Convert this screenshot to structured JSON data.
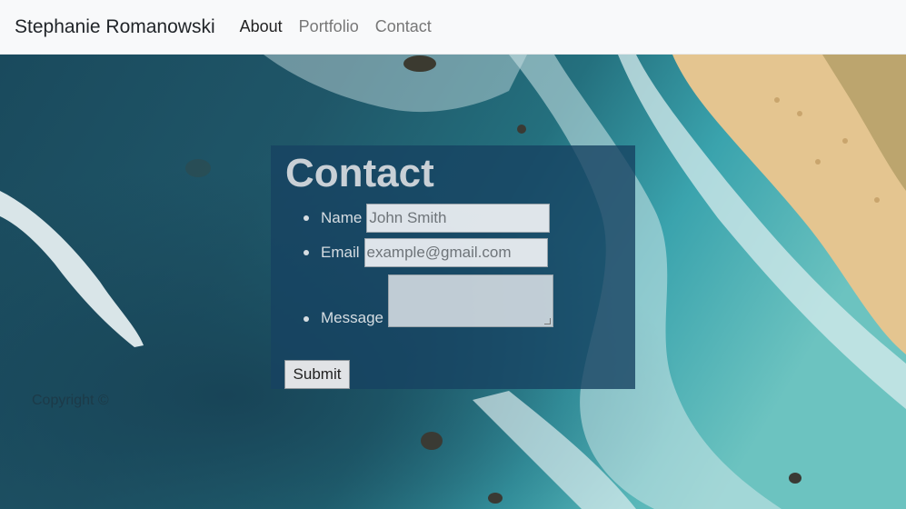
{
  "navbar": {
    "brand": "Stephanie Romanowski",
    "links": [
      "About",
      "Portfolio",
      "Contact"
    ]
  },
  "contact": {
    "title": "Contact",
    "fields": [
      {
        "label": "Name",
        "placeholder": "John Smith"
      },
      {
        "label": "Email",
        "placeholder": "example@gmail.com"
      },
      {
        "label": "Message",
        "placeholder": ""
      }
    ],
    "submit_label": "Submit"
  },
  "footer": {
    "copyright": "Copyright ©"
  },
  "colors": {
    "navbar_bg": "#f8f9fa",
    "panel_bg": "#164262",
    "ocean_deep": "#1d4e63",
    "ocean_shallow": "#3ea9b3",
    "sand": "#e7c998"
  }
}
